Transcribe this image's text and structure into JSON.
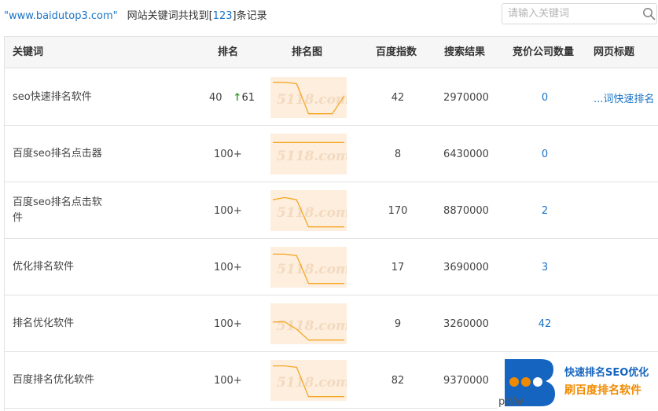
{
  "header": {
    "domain": "\"www.baidutop3.com\"",
    "prefix": "网站关键词共找到[",
    "count": "123",
    "suffix": "]条记录"
  },
  "search": {
    "placeholder": "请输入关键词",
    "icon": "search-icon"
  },
  "columns": [
    "关键词",
    "排名",
    "排名图",
    "百度指数",
    "搜索结果",
    "竞价公司数量",
    "网页标题"
  ],
  "rows": [
    {
      "keyword": "seo快速排名软件",
      "rank": "40",
      "rise": "61",
      "index": "42",
      "results": "2970000",
      "bid": "0",
      "title": "...词快速排名",
      "trend": [
        0.92,
        0.92,
        0.88,
        0.05,
        0.05,
        0.05,
        0.55
      ]
    },
    {
      "keyword": "百度seo排名点击器",
      "rank": "100+",
      "rise": "",
      "index": "8",
      "results": "6430000",
      "bid": "0",
      "title": "",
      "trend": [
        0.82,
        0.82,
        0.82,
        0.82,
        0.82,
        0.82,
        0.82
      ]
    },
    {
      "keyword": "百度seo排名点击软件",
      "rank": "100+",
      "rise": "",
      "index": "170",
      "results": "8870000",
      "bid": "2",
      "title": "",
      "trend": [
        0.8,
        0.86,
        0.8,
        0.05,
        0.05,
        0.05,
        0.05
      ]
    },
    {
      "keyword": "优化排名软件",
      "rank": "100+",
      "rise": "",
      "index": "17",
      "results": "3690000",
      "bid": "3",
      "title": "",
      "trend": [
        0.86,
        0.86,
        0.82,
        0.05,
        0.05,
        0.05,
        0.05
      ]
    },
    {
      "keyword": "排名优化软件",
      "rank": "100+",
      "rise": "",
      "index": "9",
      "results": "3260000",
      "bid": "42",
      "title": "",
      "trend": [
        0.55,
        0.55,
        0.35,
        0.05,
        0.05,
        0.05,
        0.05
      ]
    },
    {
      "keyword": "百度排名优化软件",
      "rank": "100+",
      "rise": "",
      "index": "82",
      "results": "9370000",
      "bid": "",
      "title": "",
      "trend": [
        0.9,
        0.9,
        0.86,
        0.05,
        0.05,
        0.05,
        0.05
      ]
    }
  ],
  "watermark_text": "5118.com",
  "logo": {
    "line1": "快速排名SEO优化",
    "line2": "刷百度排名软件",
    "url_fragment": "p://w",
    "accent": "#1565c0",
    "orange": "#f08a00"
  },
  "colors": {
    "link": "#1a73c6",
    "trend_line": "#f5a623",
    "trend_fill": "#fdeedd",
    "rise_arrow": "#3a9b2e"
  }
}
